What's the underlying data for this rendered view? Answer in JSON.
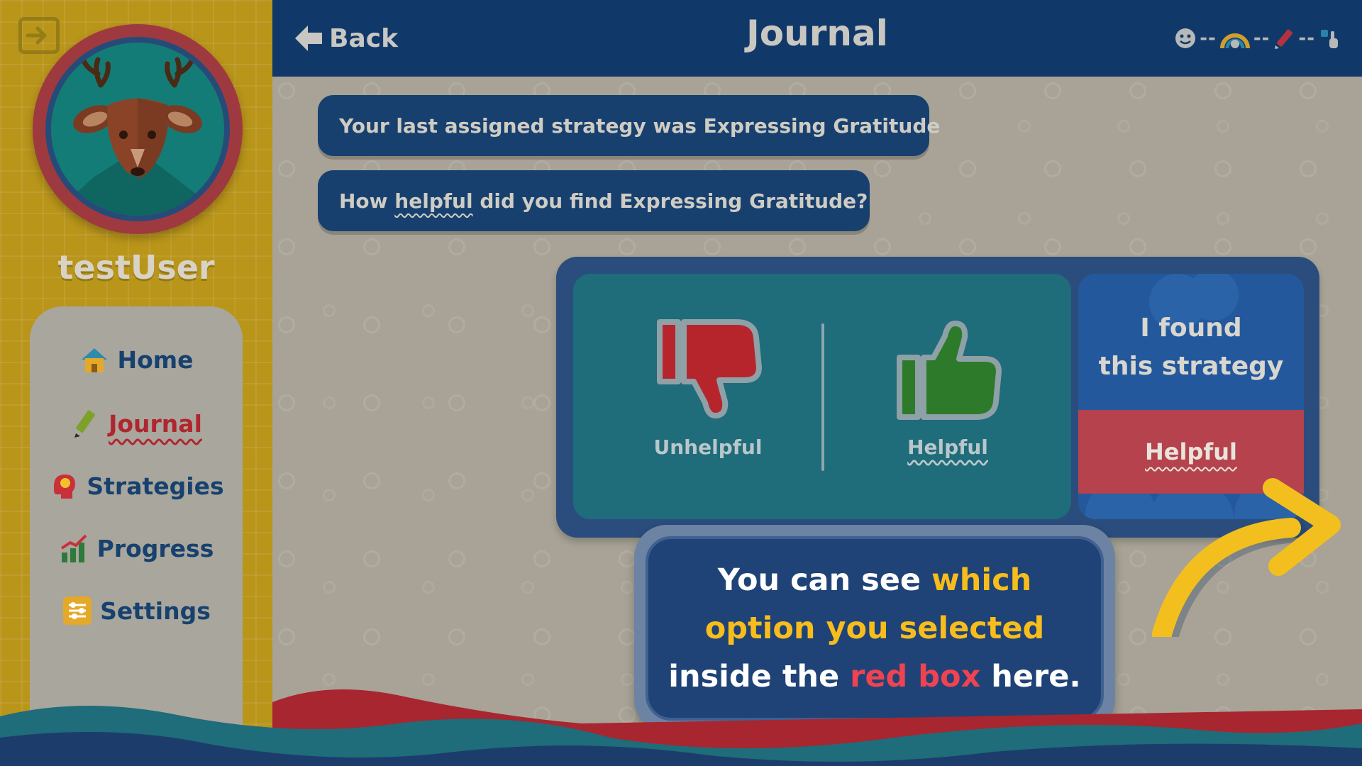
{
  "sidebar": {
    "username": "testUser",
    "avatar": {
      "icon": "deer-icon"
    },
    "logout": {
      "icon": "logout-icon"
    },
    "nav": [
      {
        "label": "Home",
        "icon": "house-icon",
        "active": false
      },
      {
        "label": "Journal",
        "icon": "pencil-icon",
        "active": true
      },
      {
        "label": "Strategies",
        "icon": "head-bulb-icon",
        "active": false
      },
      {
        "label": "Progress",
        "icon": "bar-chart-icon",
        "active": false
      },
      {
        "label": "Settings",
        "icon": "sliders-icon",
        "active": false
      }
    ]
  },
  "header": {
    "back_label": "Back",
    "title": "Journal",
    "progress_steps": [
      "smiley-icon",
      "rainbow-icon",
      "pencil-icon",
      "hand-icon"
    ]
  },
  "main": {
    "messages": [
      {
        "text": "Your last assigned strategy was Expressing Gratitude"
      },
      {
        "text_before": "How ",
        "text_highlight": "helpful",
        "text_after": " did you find Expressing Gratitude?"
      }
    ],
    "rating": {
      "options": [
        {
          "label": "Unhelpful",
          "icon": "thumbs-down-icon"
        },
        {
          "label": "Helpful",
          "icon": "thumbs-up-icon"
        }
      ],
      "result_title_line1": "I found",
      "result_title_line2": "this strategy",
      "result_value": "Helpful"
    },
    "tooltip": {
      "line1_plain": "You can see ",
      "line1_highlight": "which",
      "line2_highlight": "option you selected",
      "line3_plain_a": "inside the ",
      "line3_highlight": "red box",
      "line3_plain_b": " here."
    }
  },
  "colors": {
    "header": "#10396a",
    "sidebar": "#c9a21d",
    "highlight_yellow": "#f8bd1c",
    "highlight_red": "#ef4351",
    "selected_box": "#b5424d"
  }
}
